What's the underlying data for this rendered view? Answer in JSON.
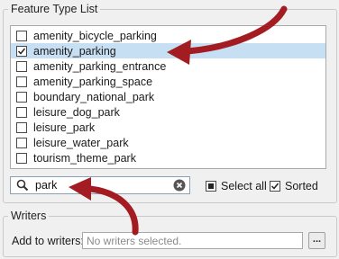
{
  "feature_list": {
    "title": "Feature Type List",
    "items": [
      {
        "label": "amenity_bicycle_parking",
        "checked": false,
        "selected": false
      },
      {
        "label": "amenity_parking",
        "checked": true,
        "selected": true
      },
      {
        "label": "amenity_parking_entrance",
        "checked": false,
        "selected": false
      },
      {
        "label": "amenity_parking_space",
        "checked": false,
        "selected": false
      },
      {
        "label": "boundary_national_park",
        "checked": false,
        "selected": false
      },
      {
        "label": "leisure_dog_park",
        "checked": false,
        "selected": false
      },
      {
        "label": "leisure_park",
        "checked": false,
        "selected": false
      },
      {
        "label": "leisure_water_park",
        "checked": false,
        "selected": false
      },
      {
        "label": "tourism_theme_park",
        "checked": false,
        "selected": false
      }
    ]
  },
  "filter": {
    "value": "park",
    "icon": "search-icon",
    "clear_icon": "clear-icon"
  },
  "options": {
    "select_all_label": "Select all",
    "select_all_state": "partial",
    "sorted_label": "Sorted",
    "sorted_checked": true
  },
  "writers": {
    "title": "Writers",
    "add_label": "Add to writers:",
    "placeholder": "No writers selected.",
    "browse_label": "..."
  },
  "colors": {
    "selection": "#c7dff3",
    "annotation_arrow": "#a31c22"
  }
}
